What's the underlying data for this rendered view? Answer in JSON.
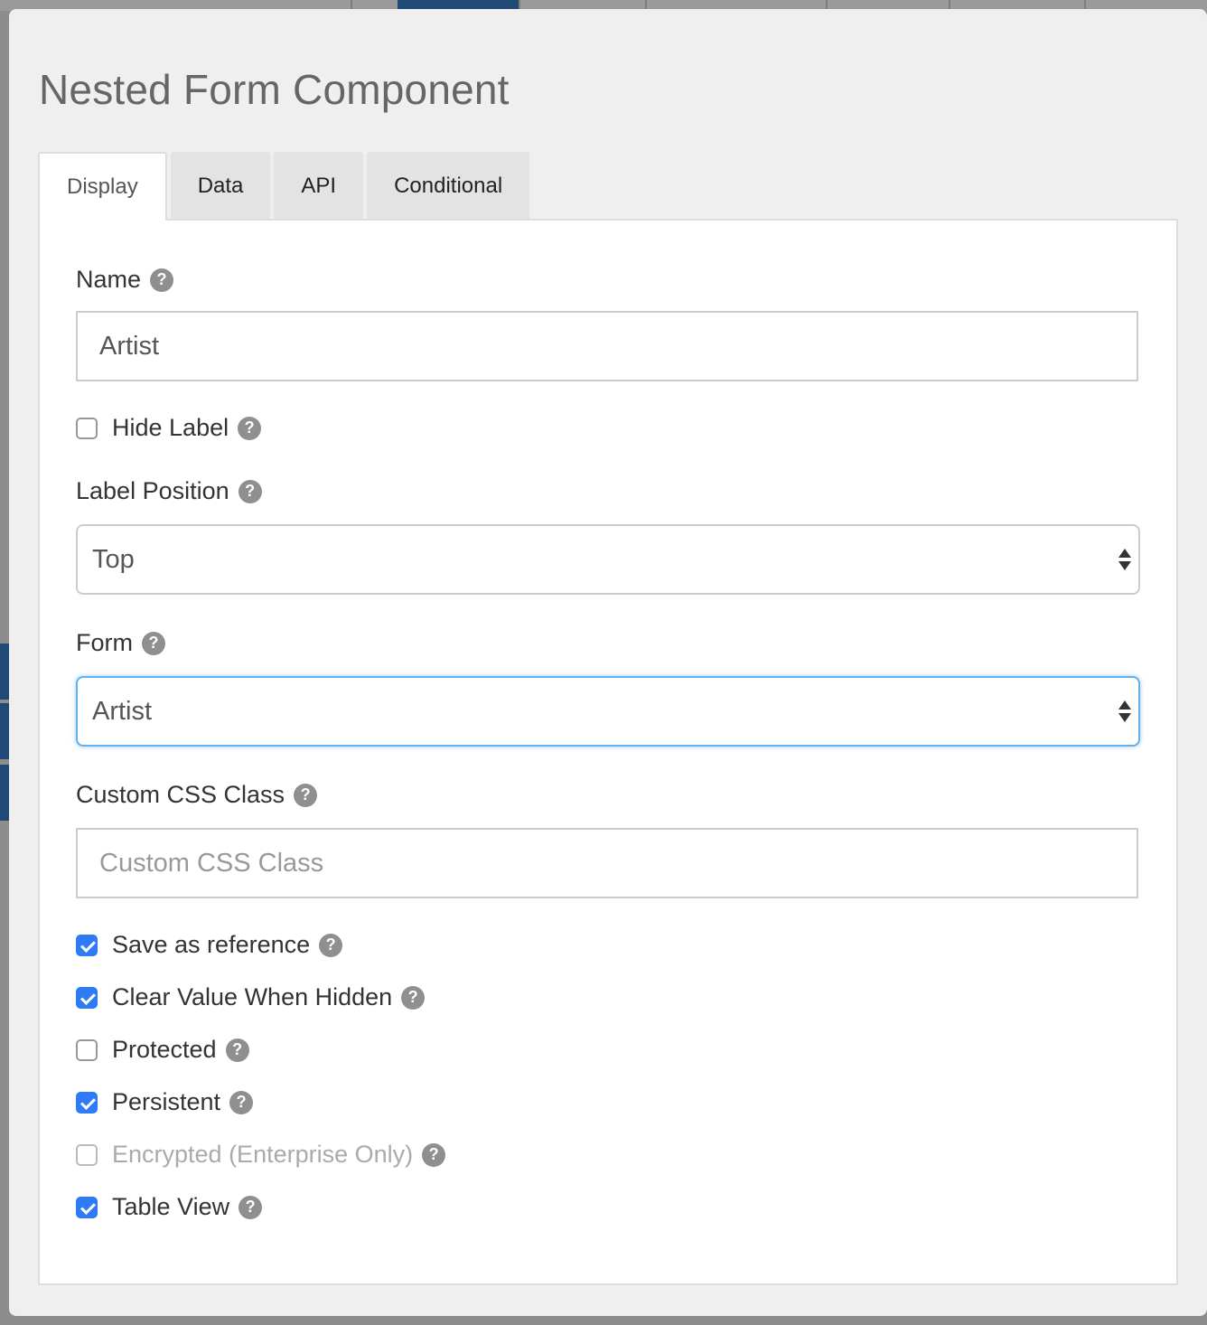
{
  "modal": {
    "title": "Nested Form Component"
  },
  "tabs": [
    {
      "label": "Display",
      "active": true
    },
    {
      "label": "Data",
      "active": false
    },
    {
      "label": "API",
      "active": false
    },
    {
      "label": "Conditional",
      "active": false
    }
  ],
  "display": {
    "name": {
      "label": "Name",
      "value": "Artist"
    },
    "hide_label": {
      "label": "Hide Label",
      "checked": false
    },
    "label_position": {
      "label": "Label Position",
      "selected": "Top"
    },
    "form": {
      "label": "Form",
      "selected": "Artist"
    },
    "custom_css": {
      "label": "Custom CSS Class",
      "value": "",
      "placeholder": "Custom CSS Class"
    },
    "checkboxes": [
      {
        "label": "Save as reference",
        "checked": true,
        "disabled": false
      },
      {
        "label": "Clear Value When Hidden",
        "checked": true,
        "disabled": false
      },
      {
        "label": "Protected",
        "checked": false,
        "disabled": false
      },
      {
        "label": "Persistent",
        "checked": true,
        "disabled": false
      },
      {
        "label": "Encrypted (Enterprise Only)",
        "checked": false,
        "disabled": true
      },
      {
        "label": "Table View",
        "checked": true,
        "disabled": false
      }
    ]
  },
  "help_glyph": "?",
  "icons": {
    "help": "question-circle-icon",
    "select": "updown-arrows-icon",
    "checkbox": "checkmark-icon"
  },
  "colors": {
    "accent": "#2f7bf5",
    "focus_border": "#66afe9",
    "modal_bg": "#efefef",
    "panel_bg": "#ffffff"
  }
}
